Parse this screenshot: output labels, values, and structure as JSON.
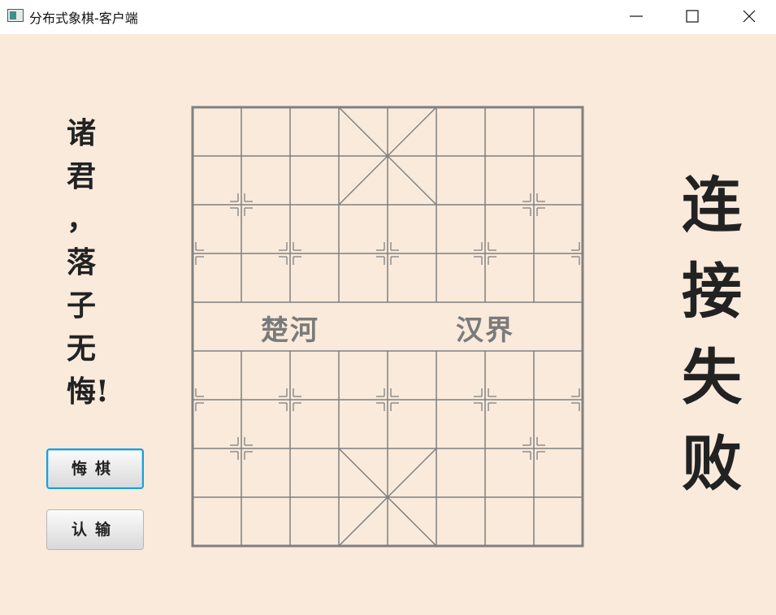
{
  "window": {
    "title": "分布式象棋-客户端",
    "app_icon": "app-window-icon",
    "controls": [
      "minimize-icon",
      "maximize-icon",
      "close-icon"
    ]
  },
  "slogan": "诸\n君\n，\n落\n子\n无\n悔!",
  "buttons": {
    "regret": "悔棋",
    "resign": "认输"
  },
  "board": {
    "river_left": "楚河",
    "river_right": "汉界"
  },
  "status": "连\n接\n失\n败",
  "colors": {
    "background": "#f9eadb",
    "board_line": "#808080",
    "focus_border": "#1a9ed8",
    "text": "#222222"
  }
}
